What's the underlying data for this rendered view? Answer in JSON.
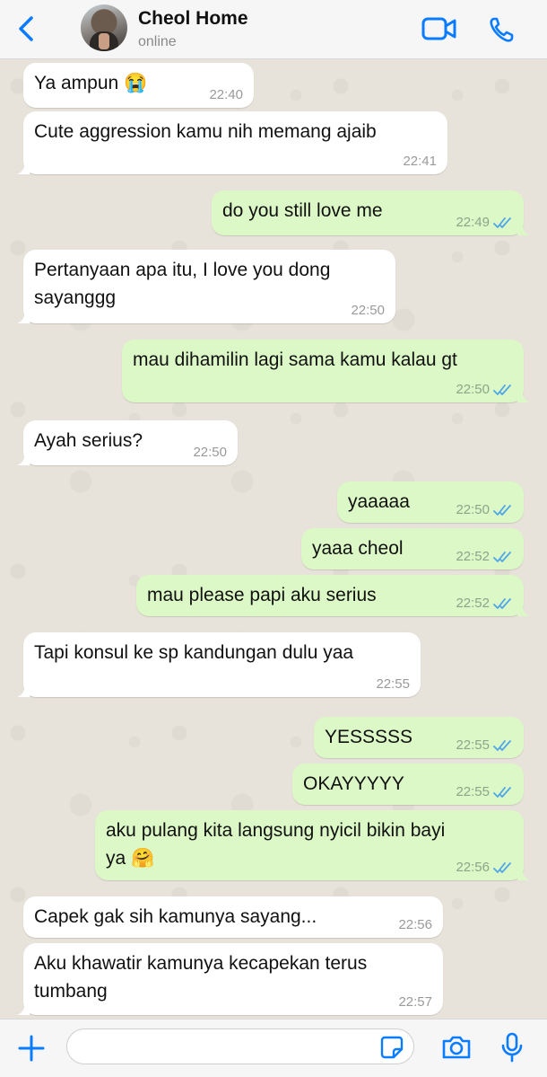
{
  "header": {
    "contact_name": "Cheol Home",
    "status": "online",
    "icons": [
      "back-chevron-icon",
      "video-call-icon",
      "phone-call-icon"
    ]
  },
  "messages": [
    {
      "dir": "in",
      "text": "Ya ampun 😭",
      "time": "22:40"
    },
    {
      "dir": "in",
      "text": "Cute aggression kamu nih memang ajaib",
      "time": "22:41"
    },
    {
      "dir": "out",
      "text": "do you still love me",
      "time": "22:49",
      "read": true
    },
    {
      "dir": "in",
      "text": "Pertanyaan apa itu, I love you dong\nsayanggg",
      "time": "22:50"
    },
    {
      "dir": "out",
      "text": "mau dihamilin lagi sama kamu kalau gt",
      "time": "22:50",
      "read": true
    },
    {
      "dir": "in",
      "text": "Ayah serius?",
      "time": "22:50"
    },
    {
      "dir": "out",
      "text": "yaaaaa",
      "time": "22:50",
      "read": true
    },
    {
      "dir": "out",
      "text": "yaaa cheol",
      "time": "22:52",
      "read": true
    },
    {
      "dir": "out",
      "text": "mau please papi aku serius",
      "time": "22:52",
      "read": true
    },
    {
      "dir": "in",
      "text": "Tapi konsul ke sp kandungan dulu yaa",
      "time": "22:55"
    },
    {
      "dir": "out",
      "text": "YESSSSS",
      "time": "22:55",
      "read": true
    },
    {
      "dir": "out",
      "text": "OKAYYYYY",
      "time": "22:55",
      "read": true
    },
    {
      "dir": "out",
      "text": "aku pulang kita langsung nyicil bikin bayi\nya 🤗",
      "time": "22:56",
      "read": true
    },
    {
      "dir": "in",
      "text": "Capek gak sih kamunya sayang...",
      "time": "22:56"
    },
    {
      "dir": "in",
      "text": "Aku khawatir kamunya kecapekan terus\ntumbang",
      "time": "22:57"
    }
  ],
  "composer": {
    "placeholder": "",
    "icons": [
      "plus-icon",
      "sticker-icon",
      "camera-icon",
      "microphone-icon"
    ]
  },
  "colors": {
    "accent": "#0a7cff",
    "incoming_bubble": "#ffffff",
    "outgoing_bubble": "#dcf8c6",
    "read_ticks": "#4fa6e8"
  }
}
